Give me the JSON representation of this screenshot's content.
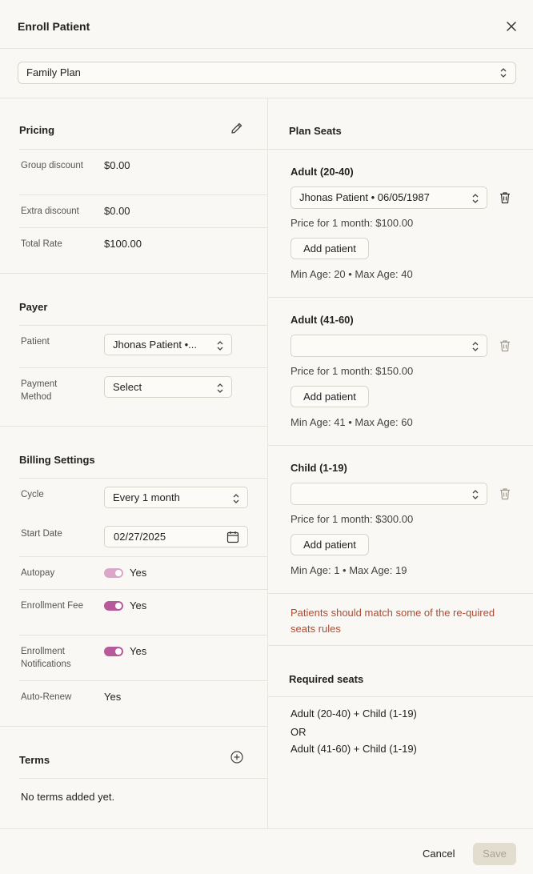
{
  "dialog": {
    "title": "Enroll Patient"
  },
  "plan": {
    "selected": "Family Plan"
  },
  "pricing": {
    "title": "Pricing",
    "rows": [
      {
        "label": "Group discount",
        "value": "$0.00"
      },
      {
        "label": "Extra discount",
        "value": "$0.00"
      },
      {
        "label": "Total Rate",
        "value": "$100.00"
      }
    ]
  },
  "payer": {
    "title": "Payer",
    "patient_label": "Patient",
    "patient_value": "Jhonas Patient •...",
    "payment_label": "Payment Method",
    "payment_value": "Select"
  },
  "billing": {
    "title": "Billing Settings",
    "cycle_label": "Cycle",
    "cycle_value": "Every 1 month",
    "start_label": "Start Date",
    "start_value": "02/27/2025",
    "autopay_label": "Autopay",
    "autopay_value": "Yes",
    "enroll_fee_label": "Enrollment Fee",
    "enroll_fee_value": "Yes",
    "notifications_label": "Enrollment Notifications",
    "notifications_value": "Yes",
    "autorenew_label": "Auto-Renew",
    "autorenew_value": "Yes"
  },
  "terms": {
    "title": "Terms",
    "empty": "No terms added yet."
  },
  "seats": {
    "title": "Plan Seats",
    "items": [
      {
        "title": "Adult (20-40)",
        "patient": "Jhonas Patient • 06/05/1987",
        "price": "Price for 1 month: $100.00",
        "add_label": "Add patient",
        "ages": "Min Age: 20 • Max Age: 40"
      },
      {
        "title": "Adult (41-60)",
        "patient": "",
        "price": "Price for 1 month: $150.00",
        "add_label": "Add patient",
        "ages": "Min Age: 41 • Max Age: 60"
      },
      {
        "title": "Child (1-19)",
        "patient": "",
        "price": "Price for 1 month: $300.00",
        "add_label": "Add patient",
        "ages": "Min Age: 1 • Max Age: 19"
      }
    ],
    "error": "Patients should match some of the re-quired seats rules"
  },
  "required": {
    "title": "Required seats",
    "lines": [
      "Adult (20-40) + Child (1-19)",
      "OR",
      "Adult (41-60) + Child (1-19)"
    ]
  },
  "footer": {
    "cancel": "Cancel",
    "save": "Save"
  },
  "colors": {
    "accent": "#b85a9a",
    "accent_light": "#dba6c8",
    "error": "#b34a2e",
    "save_bg": "#e3ddd0"
  }
}
